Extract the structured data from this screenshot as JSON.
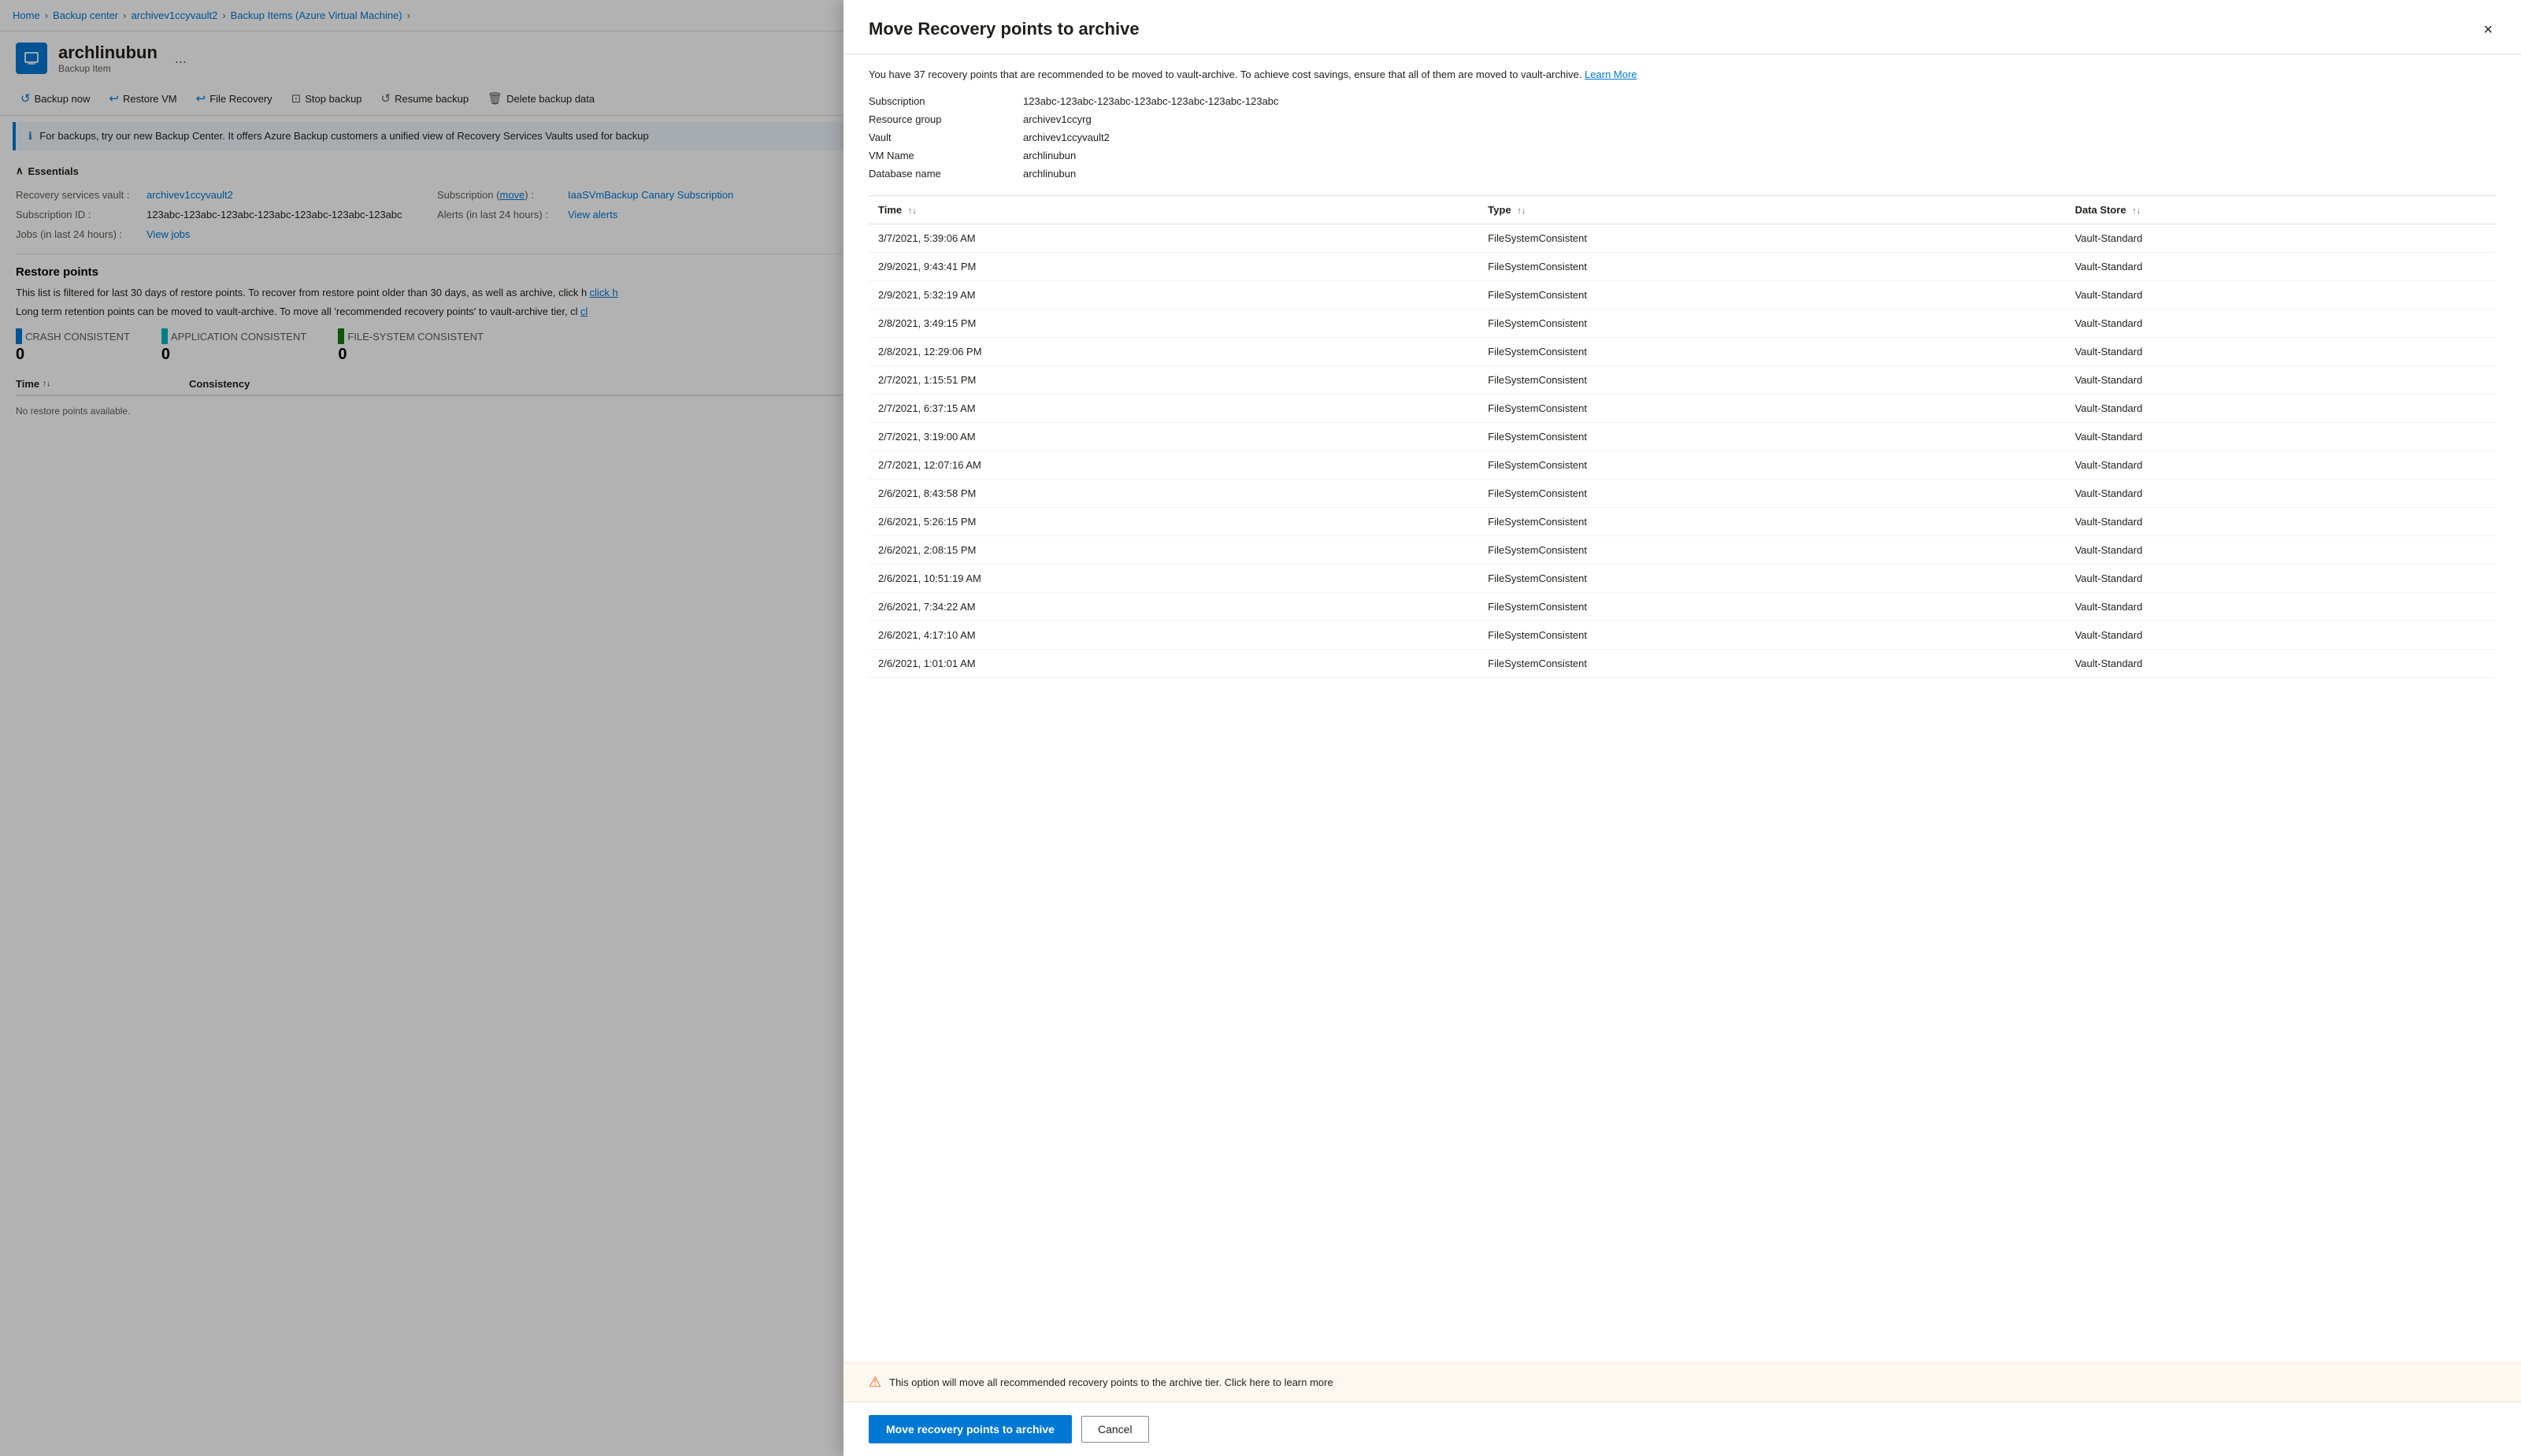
{
  "breadcrumb": {
    "home": "Home",
    "backup_center": "Backup center",
    "vault": "archivev1ccyvault2",
    "backup_items": "Backup Items (Azure Virtual Machine)"
  },
  "resource": {
    "name": "archlinubun",
    "subtitle": "Backup Item",
    "ellipsis": "..."
  },
  "toolbar": {
    "backup_now": "Backup now",
    "restore_vm": "Restore VM",
    "file_recovery": "File Recovery",
    "stop_backup": "Stop backup",
    "resume_backup": "Resume backup",
    "delete_backup": "Delete backup data"
  },
  "info_bar": {
    "text": "For backups, try our new Backup Center. It offers Azure Backup customers a unified view of Recovery Services Vaults used for backup"
  },
  "essentials": {
    "title": "Essentials",
    "fields": [
      {
        "label": "Recovery services vault",
        "value": "archivev1ccyvault2",
        "link": true
      },
      {
        "label": "Subscription (move)",
        "value": "IaaSVmBackup Canary Subscription",
        "link": true
      },
      {
        "label": "Subscription ID",
        "value": "123abc-123abc-123abc-123abc-123abc-123abc-123abc"
      },
      {
        "label": "Alerts (in last 24 hours)",
        "value": "View alerts",
        "link": true
      },
      {
        "label": "Jobs (in last 24 hours)",
        "value": "View jobs",
        "link": true
      }
    ]
  },
  "restore_points": {
    "title": "Restore points",
    "desc1": "This list is filtered for last 30 days of restore points. To recover from restore point older than 30 days, as well as archive, click h",
    "desc2": "Long term retention points can be moved to vault-archive. To move all 'recommended recovery points' to vault-archive tier, cl",
    "stats": [
      {
        "label": "CRASH CONSISTENT",
        "value": "0",
        "color": "#0078d4"
      },
      {
        "label": "APPLICATION CONSISTENT",
        "value": "0",
        "color": "#00b7c3"
      },
      {
        "label": "FILE-SYSTEM CONSISTENT",
        "value": "0",
        "color": "#107c10"
      }
    ],
    "table_headers": [
      "Time",
      "Consistency"
    ],
    "no_data": "No restore points available."
  },
  "panel": {
    "title": "Move Recovery points to archive",
    "close_label": "×",
    "description": "You have 37 recovery points that are recommended to be moved to vault-archive. To achieve cost savings, ensure that all of them are moved to vault-archive.",
    "learn_more": "Learn More",
    "info_fields": [
      {
        "label": "Subscription",
        "value": "123abc-123abc-123abc-123abc-123abc-123abc-123abc"
      },
      {
        "label": "Resource group",
        "value": "archivev1ccyrg"
      },
      {
        "label": "Vault",
        "value": "archivev1ccyvault2"
      },
      {
        "label": "VM Name",
        "value": "archlinubun"
      },
      {
        "label": "Database name",
        "value": "archlinubun"
      }
    ],
    "table_headers": [
      {
        "label": "Time",
        "sortable": true
      },
      {
        "label": "Type",
        "sortable": true
      },
      {
        "label": "Data Store",
        "sortable": true
      }
    ],
    "rows": [
      {
        "time": "3/7/2021, 5:39:06 AM",
        "type": "FileSystemConsistent",
        "datastore": "Vault-Standard"
      },
      {
        "time": "2/9/2021, 9:43:41 PM",
        "type": "FileSystemConsistent",
        "datastore": "Vault-Standard"
      },
      {
        "time": "2/9/2021, 5:32:19 AM",
        "type": "FileSystemConsistent",
        "datastore": "Vault-Standard"
      },
      {
        "time": "2/8/2021, 3:49:15 PM",
        "type": "FileSystemConsistent",
        "datastore": "Vault-Standard"
      },
      {
        "time": "2/8/2021, 12:29:06 PM",
        "type": "FileSystemConsistent",
        "datastore": "Vault-Standard"
      },
      {
        "time": "2/7/2021, 1:15:51 PM",
        "type": "FileSystemConsistent",
        "datastore": "Vault-Standard"
      },
      {
        "time": "2/7/2021, 6:37:15 AM",
        "type": "FileSystemConsistent",
        "datastore": "Vault-Standard"
      },
      {
        "time": "2/7/2021, 3:19:00 AM",
        "type": "FileSystemConsistent",
        "datastore": "Vault-Standard"
      },
      {
        "time": "2/7/2021, 12:07:16 AM",
        "type": "FileSystemConsistent",
        "datastore": "Vault-Standard"
      },
      {
        "time": "2/6/2021, 8:43:58 PM",
        "type": "FileSystemConsistent",
        "datastore": "Vault-Standard"
      },
      {
        "time": "2/6/2021, 5:26:15 PM",
        "type": "FileSystemConsistent",
        "datastore": "Vault-Standard"
      },
      {
        "time": "2/6/2021, 2:08:15 PM",
        "type": "FileSystemConsistent",
        "datastore": "Vault-Standard"
      },
      {
        "time": "2/6/2021, 10:51:19 AM",
        "type": "FileSystemConsistent",
        "datastore": "Vault-Standard"
      },
      {
        "time": "2/6/2021, 7:34:22 AM",
        "type": "FileSystemConsistent",
        "datastore": "Vault-Standard"
      },
      {
        "time": "2/6/2021, 4:17:10 AM",
        "type": "FileSystemConsistent",
        "datastore": "Vault-Standard"
      },
      {
        "time": "2/6/2021, 1:01:01 AM",
        "type": "FileSystemConsistent",
        "datastore": "Vault-Standard"
      }
    ],
    "warning_text": "This option will move all recommended recovery points to the archive tier. Click here to learn more",
    "move_btn": "Move recovery points to archive",
    "cancel_btn": "Cancel"
  }
}
